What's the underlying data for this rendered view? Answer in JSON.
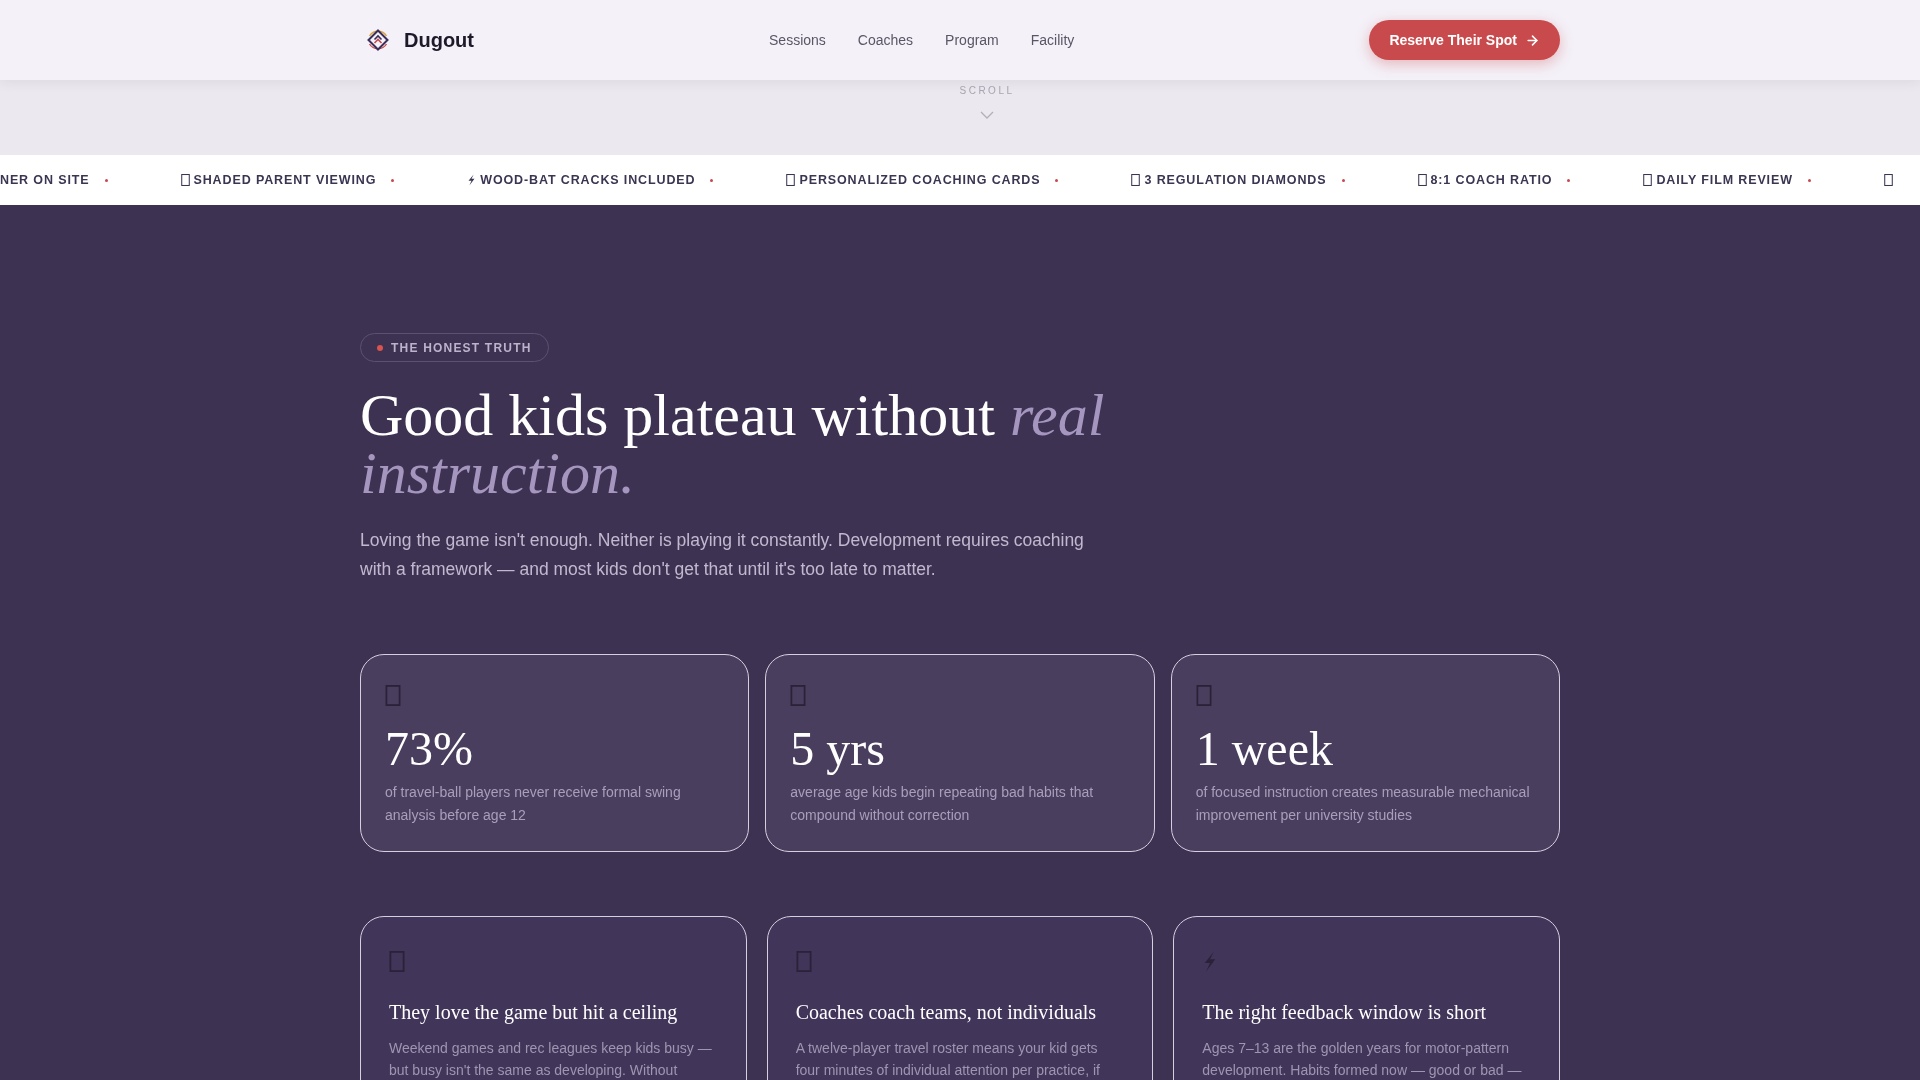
{
  "header": {
    "brand": "Dugout",
    "nav": [
      "Sessions",
      "Coaches",
      "Program",
      "Facility"
    ],
    "cta": "Reserve Their Spot"
  },
  "scroll_hint": "SCROLL",
  "ticker": [
    {
      "kind": "plain",
      "label": "NER ON SITE"
    },
    {
      "kind": "box",
      "label": "SHADED PARENT VIEWING"
    },
    {
      "kind": "bolt",
      "label": "WOOD-BAT CRACKS INCLUDED"
    },
    {
      "kind": "box",
      "label": "PERSONALIZED COACHING CARDS"
    },
    {
      "kind": "box",
      "label": "3 REGULATION DIAMONDS"
    },
    {
      "kind": "box",
      "label": "8:1 COACH RATIO"
    },
    {
      "kind": "box",
      "label": "DAILY FILM REVIEW"
    },
    {
      "kind": "box"
    }
  ],
  "intro": {
    "badge": "THE HONEST TRUTH",
    "heading": "Good kids plateau without *real instruction.*",
    "body": "Loving the game isn't enough. Neither is playing it constantly. Development requires coaching with a framework — and most kids don't get that until it's too late to matter."
  },
  "stats": [
    {
      "value": "73%",
      "text": "of travel-ball players never receive formal swing analysis before age 12"
    },
    {
      "value": "5 yrs",
      "text": "average age kids begin repeating bad habits that compound without correction"
    },
    {
      "value": "1 week",
      "text": "of focused instruction creates measurable mechanical improvement per university studies"
    }
  ],
  "problems": [
    {
      "kind": "box",
      "title": "They love the game but hit a ceiling",
      "text": "Weekend games and rec leagues keep kids busy — but busy isn't the same as developing. Without"
    },
    {
      "kind": "box",
      "title": "Coaches coach teams, not individuals",
      "text": "A twelve-player travel roster means your kid gets four minutes of individual attention per practice, if"
    },
    {
      "kind": "bolt",
      "title": "The right feedback window is short",
      "text": "Ages 7–13 are the golden years for motor-pattern development. Habits formed now — good or bad —"
    }
  ]
}
